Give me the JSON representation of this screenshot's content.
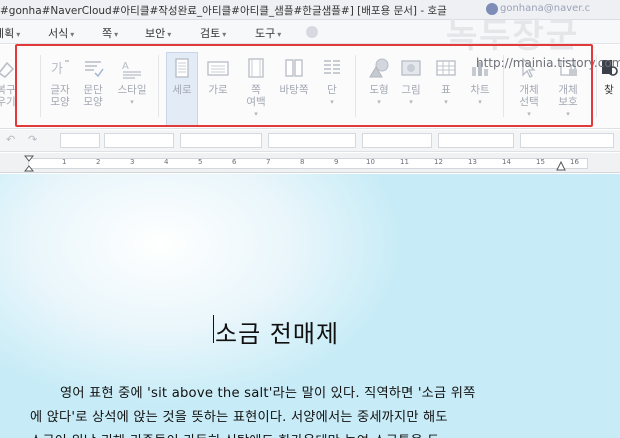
{
  "window": {
    "title": "#gonha#NaverCloud#아티클#작성완료_아티클#아티클_샘플#한글샘플#] [배포용 문서] - 호글",
    "account": "gonhana@naver.c"
  },
  "menu": {
    "items": [
      {
        "label": "계획"
      },
      {
        "label": "서식"
      },
      {
        "label": "쪽"
      },
      {
        "label": "보안"
      },
      {
        "label": "검토"
      },
      {
        "label": "도구"
      }
    ]
  },
  "ribbon": {
    "tools": [
      {
        "label": "복구\n우기",
        "icon": "eraser-icon"
      },
      {
        "label": "글자\n모양",
        "icon": "char-shape-icon"
      },
      {
        "label": "문단\n모양",
        "icon": "paragraph-shape-icon"
      },
      {
        "label": "스타일",
        "icon": "style-icon"
      },
      {
        "label": "세로",
        "icon": "portrait-icon"
      },
      {
        "label": "가로",
        "icon": "landscape-icon"
      },
      {
        "label": "쪽\n여백",
        "icon": "margin-icon"
      },
      {
        "label": "바탕쪽",
        "icon": "master-page-icon"
      },
      {
        "label": "단",
        "icon": "columns-icon"
      },
      {
        "label": "도형",
        "icon": "shape-icon"
      },
      {
        "label": "그림",
        "icon": "picture-icon"
      },
      {
        "label": "표",
        "icon": "table-icon"
      },
      {
        "label": "차트",
        "icon": "chart-icon"
      },
      {
        "label": "개체\n선택",
        "icon": "select-object-icon"
      },
      {
        "label": "개체\n보호",
        "icon": "protect-object-icon"
      },
      {
        "label": "찾",
        "icon": "find-icon"
      }
    ]
  },
  "watermark": {
    "title": "녹두장군",
    "url": "http://mainia.tistory.com"
  },
  "ruler": {
    "numbers": [
      "1",
      "2",
      "3",
      "4",
      "5",
      "6",
      "7",
      "8",
      "9",
      "10",
      "11",
      "12",
      "13",
      "14",
      "15",
      "16"
    ]
  },
  "document": {
    "heading": "소금 전매제",
    "lines": [
      "영어 표현 중에 'sit above the salt'라는 말이 있다. 직역하면 '소금 위쪽",
      "에 앉다'로 상석에 앉는 것을 뜻하는 표현이다. 서양에서는 중세까지만 해도",
      "소금이 워낙 귀해 귀족들이 가득히 식탁에도 한가운데만 놓여 소금통을 두"
    ]
  },
  "colors": {
    "highlight_box": "#e23a3a",
    "page_background": "#c8ecf7"
  }
}
